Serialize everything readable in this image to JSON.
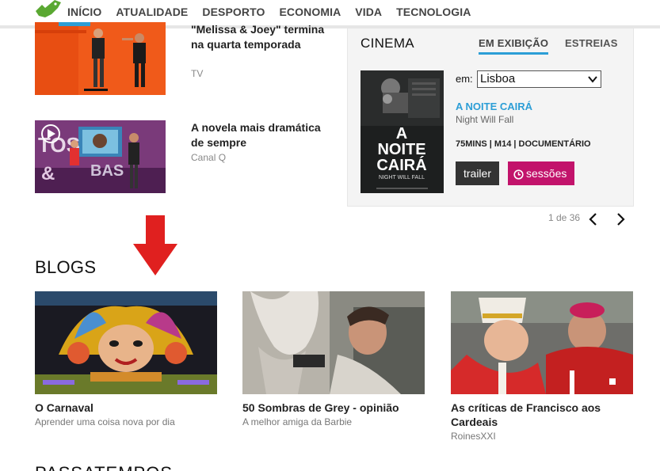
{
  "nav": {
    "items": [
      "INÍCIO",
      "ATUALIDADE",
      "DESPORTO",
      "ECONOMIA",
      "VIDA",
      "TECNOLOGIA"
    ]
  },
  "news": [
    {
      "title": "\"Melissa & Joey\" termina na quarta temporada",
      "source": "TV"
    },
    {
      "title": "A novela mais dramática de sempre",
      "source": "Canal Q"
    }
  ],
  "cinema": {
    "title": "CINEMA",
    "tabs": [
      "EM EXIBIÇÃO",
      "ESTREIAS"
    ],
    "active_tab": "EM EXIBIÇÃO",
    "em_label": "em:",
    "city": "Lisboa",
    "movie": {
      "title": "A NOITE CAIRÁ",
      "original_title": "Night Will Fall",
      "meta": "75MINS | M14 | DOCUMENTÁRIO",
      "poster_text": [
        "A",
        "NOITE",
        "CAIRÁ"
      ],
      "poster_sub": "NIGHT WILL FALL"
    },
    "trailer_label": "trailer",
    "sessoes_label": "sessões",
    "pager": "1 de 36"
  },
  "blogs": {
    "heading": "BLOGS",
    "items": [
      {
        "title": "O Carnaval",
        "subtitle": "Aprender uma coisa nova por dia"
      },
      {
        "title": "50 Sombras de Grey - opinião",
        "subtitle": "A melhor amiga da Barbie"
      },
      {
        "title": "As críticas de Francisco aos Cardeais",
        "subtitle": "RoinesXXI"
      }
    ]
  },
  "next_section": {
    "heading": "PASSATEMPOS"
  },
  "colors": {
    "accent_blue": "#2c9ed6",
    "accent_magenta": "#c2136b",
    "logo_green": "#5aa832",
    "arrow_red": "#e0201f"
  }
}
